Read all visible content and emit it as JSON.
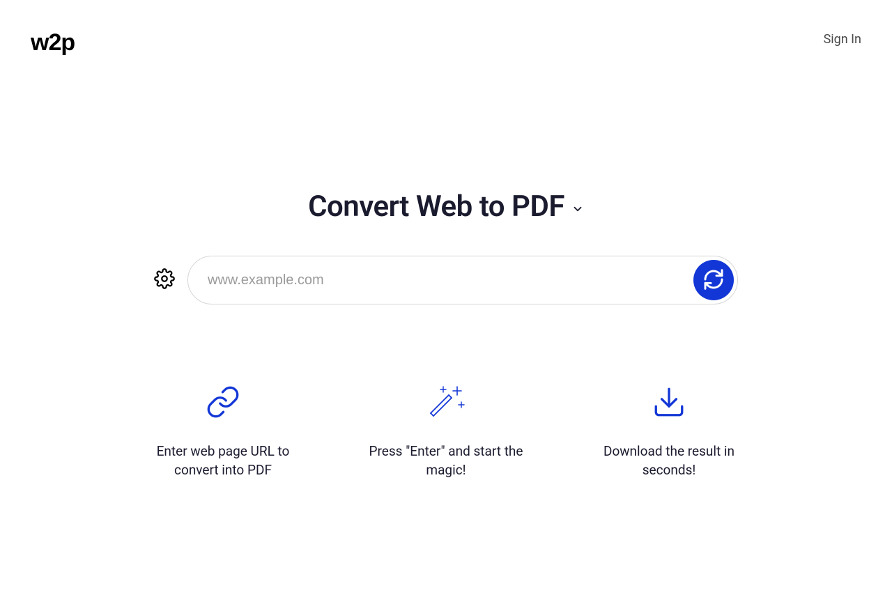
{
  "header": {
    "logo": "w2p",
    "signin": "Sign In"
  },
  "main": {
    "title": "Convert Web to PDF",
    "url_placeholder": "www.example.com"
  },
  "steps": [
    {
      "text": "Enter web page URL to convert into PDF"
    },
    {
      "text": "Press \"Enter\" and start the magic!"
    },
    {
      "text": "Download the result in seconds!"
    }
  ],
  "colors": {
    "accent": "#1337d6"
  }
}
